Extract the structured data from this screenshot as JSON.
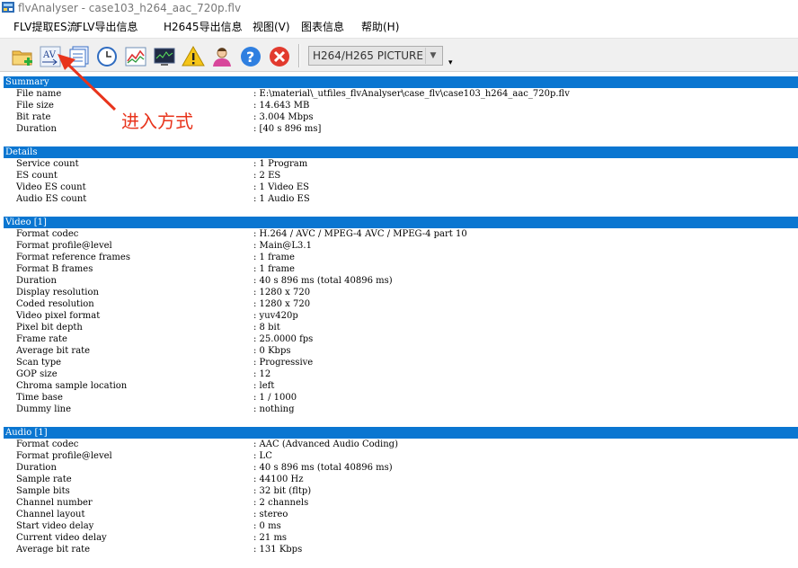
{
  "window": {
    "title": "flvAnalyser - case103_h264_aac_720p.flv"
  },
  "menu": [
    "FLV提取ES流",
    "FLV导出信息",
    "H2645导出信息",
    "视图(V)",
    "图表信息",
    "帮助(H)"
  ],
  "toolbar": {
    "buttons": [
      "open-folder-icon",
      "av-icon",
      "frames-icon",
      "clock-icon",
      "line-chart-icon",
      "monitor-chart-icon",
      "warning-icon",
      "user-icon",
      "help-icon",
      "close-icon"
    ],
    "picture_select": "H264/H265 PICTURE"
  },
  "annotation": {
    "text": "进入方式",
    "color": "#e8341c"
  },
  "report": {
    "summary": {
      "title": "Summary",
      "rows": [
        {
          "k": "File name",
          "v": ": E:\\material\\_utfiles_flvAnalyser\\case_flv\\case103_h264_aac_720p.flv"
        },
        {
          "k": "File size",
          "v": ": 14.643 MB"
        },
        {
          "k": "Bit rate",
          "v": ": 3.004 Mbps"
        },
        {
          "k": "Duration",
          "v": ": [40 s 896 ms]"
        }
      ]
    },
    "details": {
      "title": "Details",
      "rows": [
        {
          "k": "Service count",
          "v": ": 1 Program"
        },
        {
          "k": "ES count",
          "v": ": 2 ES"
        },
        {
          "k": "Video ES count",
          "v": ": 1 Video ES"
        },
        {
          "k": "Audio ES count",
          "v": ": 1 Audio ES"
        }
      ]
    },
    "video": {
      "title": "Video [1]",
      "rows": [
        {
          "k": "Format codec",
          "v": ": H.264 / AVC / MPEG-4 AVC / MPEG-4 part 10"
        },
        {
          "k": "Format profile@level",
          "v": ": Main@L3.1"
        },
        {
          "k": "Format reference frames",
          "v": ": 1 frame"
        },
        {
          "k": "Format B frames",
          "v": ": 1 frame"
        },
        {
          "k": "Duration",
          "v": ": 40 s 896 ms (total 40896 ms)"
        },
        {
          "k": "Display resolution",
          "v": ": 1280 x 720"
        },
        {
          "k": "Coded resolution",
          "v": ": 1280 x 720"
        },
        {
          "k": "Video pixel format",
          "v": ": yuv420p"
        },
        {
          "k": "Pixel bit depth",
          "v": ": 8 bit"
        },
        {
          "k": "Frame rate",
          "v": ": 25.0000 fps"
        },
        {
          "k": "Average bit rate",
          "v": ": 0 Kbps"
        },
        {
          "k": "Scan type",
          "v": ": Progressive"
        },
        {
          "k": "GOP size",
          "v": ": 12"
        },
        {
          "k": "Chroma sample location",
          "v": ": left"
        },
        {
          "k": "Time base",
          "v": ": 1 / 1000"
        },
        {
          "k": "Dummy line",
          "v": ": nothing"
        }
      ]
    },
    "audio": {
      "title": "Audio [1]",
      "rows": [
        {
          "k": "Format codec",
          "v": ": AAC (Advanced Audio Coding)"
        },
        {
          "k": "Format profile@level",
          "v": ": LC"
        },
        {
          "k": "Duration",
          "v": ": 40 s 896 ms (total 40896 ms)"
        },
        {
          "k": "Sample rate",
          "v": ": 44100 Hz"
        },
        {
          "k": "Sample bits",
          "v": ": 32 bit (fltp)"
        },
        {
          "k": "Channel number",
          "v": ": 2 channels"
        },
        {
          "k": "Channel layout",
          "v": ": stereo"
        },
        {
          "k": "Start video delay",
          "v": ": 0 ms"
        },
        {
          "k": "Current video delay",
          "v": ": 21 ms"
        },
        {
          "k": "Average bit rate",
          "v": ": 131 Kbps"
        }
      ]
    }
  }
}
